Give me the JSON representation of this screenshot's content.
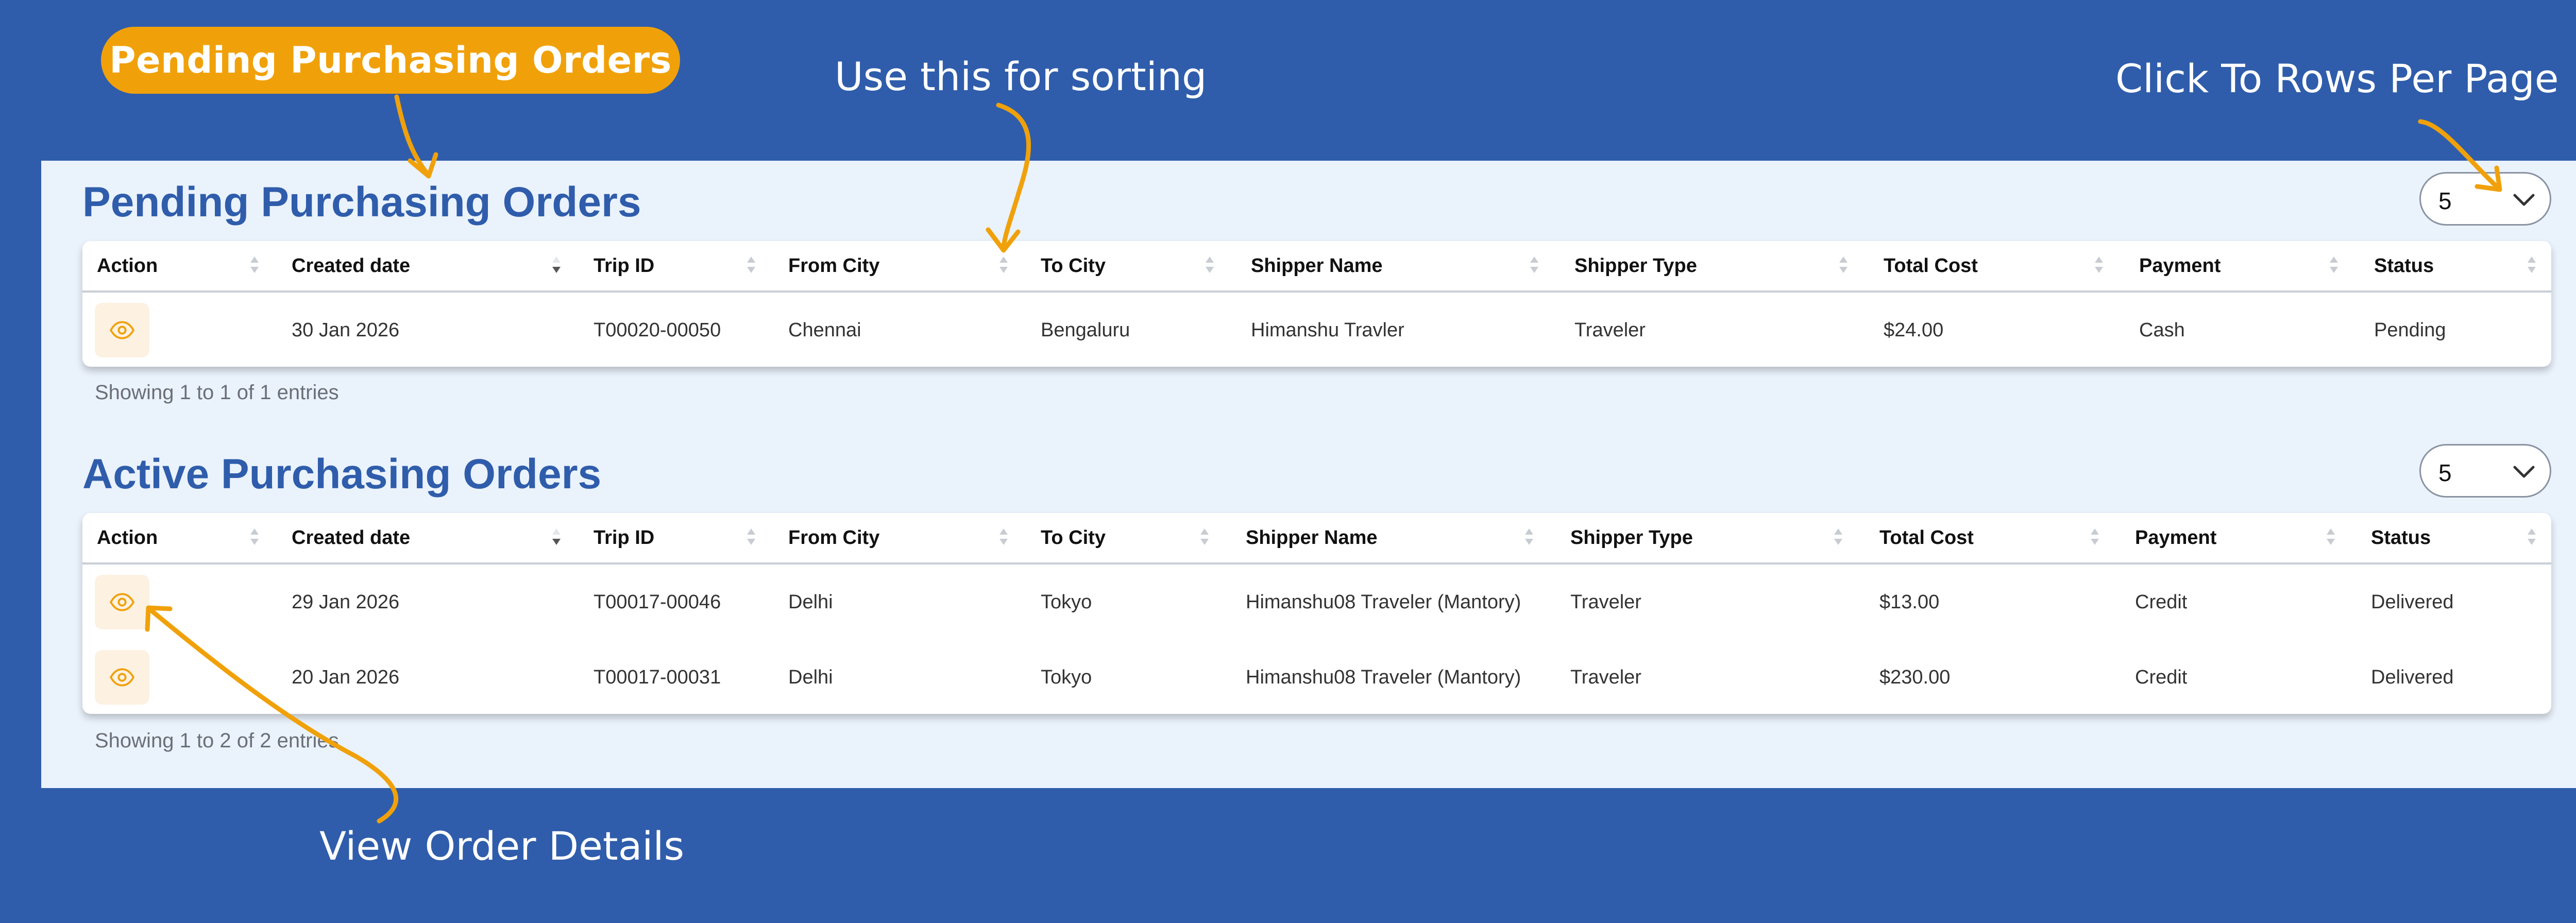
{
  "annotations": {
    "pill": "Pending Purchasing Orders",
    "sorting": "Use this for sorting",
    "rows_per_page": "Click To Rows Per Page",
    "view_details": "View Order Details"
  },
  "colors": {
    "background": "#2f5dab",
    "panel": "#eaf2fc",
    "accent": "#f0a10a",
    "title": "#2f5dab"
  },
  "icons": {
    "view": "eye-icon",
    "dropdown": "chevron-down-icon",
    "sort": "sort-arrows-icon"
  },
  "pending": {
    "title": "Pending Purchasing Orders",
    "rows_per_page": "5",
    "columns": [
      "Action",
      "Created date",
      "Trip ID",
      "From City",
      "To City",
      "Shipper Name",
      "Shipper Type",
      "Total Cost",
      "Payment",
      "Status"
    ],
    "sorted_column": "Created date",
    "rows": [
      {
        "created": "30 Jan 2026",
        "trip_id": "T00020-00050",
        "from": "Chennai",
        "to": "Bengaluru",
        "shipper_name": "Himanshu Travler",
        "shipper_type": "Traveler",
        "total": "$24.00",
        "payment": "Cash",
        "status": "Pending"
      }
    ],
    "entries": "Showing 1 to 1 of 1 entries"
  },
  "active": {
    "title": "Active Purchasing Orders",
    "rows_per_page": "5",
    "columns": [
      "Action",
      "Created date",
      "Trip ID",
      "From City",
      "To City",
      "Shipper Name",
      "Shipper Type",
      "Total Cost",
      "Payment",
      "Status"
    ],
    "sorted_column": "Created date",
    "rows": [
      {
        "created": "29 Jan 2026",
        "trip_id": "T00017-00046",
        "from": "Delhi",
        "to": "Tokyo",
        "shipper_name": "Himanshu08 Traveler (Mantory)",
        "shipper_type": "Traveler",
        "total": "$13.00",
        "payment": "Credit",
        "status": "Delivered"
      },
      {
        "created": "20 Jan 2026",
        "trip_id": "T00017-00031",
        "from": "Delhi",
        "to": "Tokyo",
        "shipper_name": "Himanshu08 Traveler (Mantory)",
        "shipper_type": "Traveler",
        "total": "$230.00",
        "payment": "Credit",
        "status": "Delivered"
      }
    ],
    "entries": "Showing 1 to 2 of 2 entries"
  }
}
